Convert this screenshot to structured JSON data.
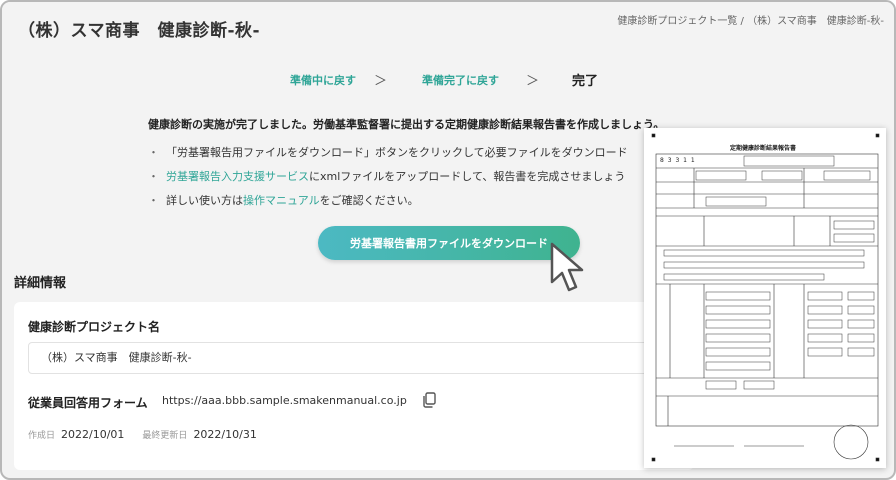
{
  "header": {
    "title": "（株）スマ商事　健康診断-秋-",
    "breadcrumb_1": "健康診断プロジェクト一覧",
    "breadcrumb_sep": " / ",
    "breadcrumb_2": "（株）スマ商事　健康診断-秋-"
  },
  "steps": {
    "back_preparing": "準備中に戻す",
    "back_ready": "準備完了に戻す",
    "current": "完了",
    "chevron": "＞"
  },
  "message": {
    "intro": "健康診断の実施が完了しました。労働基準監督署に提出する定期健康診断結果報告書を作成しましょう。",
    "bullet_marker": "・",
    "bullet1": "「労基署報告用ファイルをダウンロード」ボタンをクリックして必要ファイルをダウンロード",
    "bullet2_link": "労基署報告入力支援サービス",
    "bullet2_rest": "にxmlファイルをアップロードして、報告書を完成させましょう",
    "bullet3_pre": "詳しい使い方は",
    "bullet3_link": "操作マニュアル",
    "bullet3_post": "をご確認ください。"
  },
  "download_button": "労基署報告書用ファイルをダウンロード",
  "details": {
    "heading": "詳細情報",
    "project_label": "健康診断プロジェクト名",
    "project_value": "（株）スマ商事　健康診断-秋-",
    "form_label": "従業員回答用フォーム",
    "form_url": "https://aaa.bbb.sample.smakenmanual.co.jp",
    "created_label": "作成日",
    "created_value": "2022/10/01",
    "updated_label": "最終更新日",
    "updated_value": "2022/10/31"
  },
  "report_preview": {
    "title": "定期健康診断結果報告書",
    "code": "8 3 3 1 1"
  },
  "colors": {
    "accent": "#2fa597",
    "button_start": "#4cb9c3",
    "button_end": "#3fb38f",
    "background": "#f3f3f3"
  },
  "icons": [
    "copy-icon",
    "mouse-pointer-icon",
    "chevron-right-icon"
  ]
}
